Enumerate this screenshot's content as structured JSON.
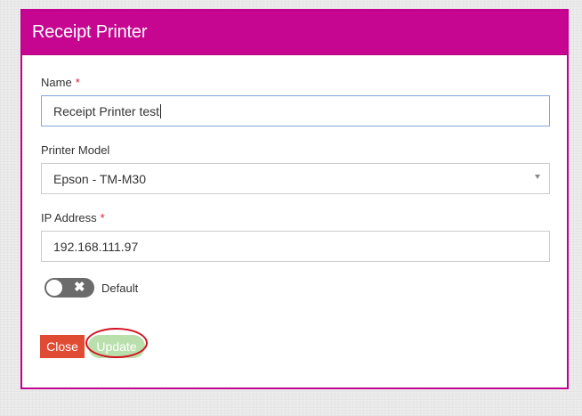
{
  "dialog": {
    "title": "Receipt Printer"
  },
  "form": {
    "name": {
      "label": "Name",
      "required_mark": "*",
      "value": "Receipt Printer test"
    },
    "printer_model": {
      "label": "Printer Model",
      "selected": "Epson - TM-M30"
    },
    "ip_address": {
      "label": "IP Address",
      "required_mark": "*",
      "value": "192.168.111.97"
    },
    "default_toggle": {
      "label": "Default",
      "state": "off",
      "icon": "close-icon"
    }
  },
  "buttons": {
    "close_label": "Close",
    "update_label": "Update"
  },
  "colors": {
    "header": "#c60590",
    "close_button": "#e04b34",
    "update_button": "#b9e0ac",
    "annotation_ring": "#d4101f"
  }
}
